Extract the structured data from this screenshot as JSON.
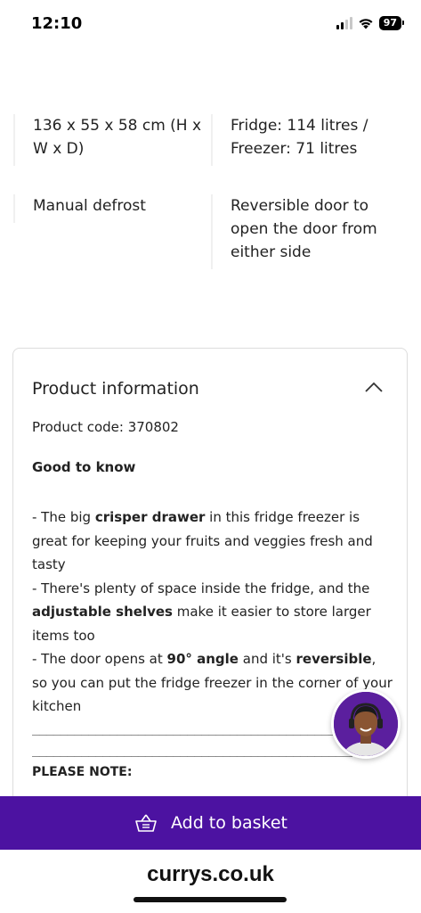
{
  "status_bar": {
    "time": "12:10",
    "battery": "97"
  },
  "specs": {
    "dimensions": "136 x 55 x 58 cm (H x W x D)",
    "capacity": "Fridge: 114 litres / Freezer: 71 litres",
    "defrost": "Manual defrost",
    "door": "Reversible door to open the door from either side"
  },
  "product_info": {
    "title": "Product information",
    "product_code": "Product code: 370802",
    "good_to_know": "Good to know",
    "bullet1_pre": "- The big ",
    "bullet1_bold": "crisper drawer",
    "bullet1_post": " in this fridge freezer is great for keeping your fruits and veggies fresh and tasty",
    "bullet2_pre": "- There's plenty of space inside the fridge, and the ",
    "bullet2_bold": "adjustable shelves",
    "bullet2_post": " make it easier to store larger items too",
    "bullet3_pre": "- The door opens at ",
    "bullet3_bold1": "90° angle",
    "bullet3_mid": " and it's ",
    "bullet3_bold2": "reversible",
    "bullet3_post": ", so you can put the fridge freezer in the corner of your kitchen",
    "dashes": "______________________________________________",
    "please_note": "PLEASE NOTE:"
  },
  "actions": {
    "add_to_basket": "Add to basket"
  },
  "footer": {
    "site": "currys.co.uk"
  },
  "colors": {
    "brand_purple": "#4c12a1"
  },
  "icons": {
    "collapse": "chevron-up-icon",
    "basket": "basket-icon",
    "chat": "chat-agent-avatar"
  }
}
